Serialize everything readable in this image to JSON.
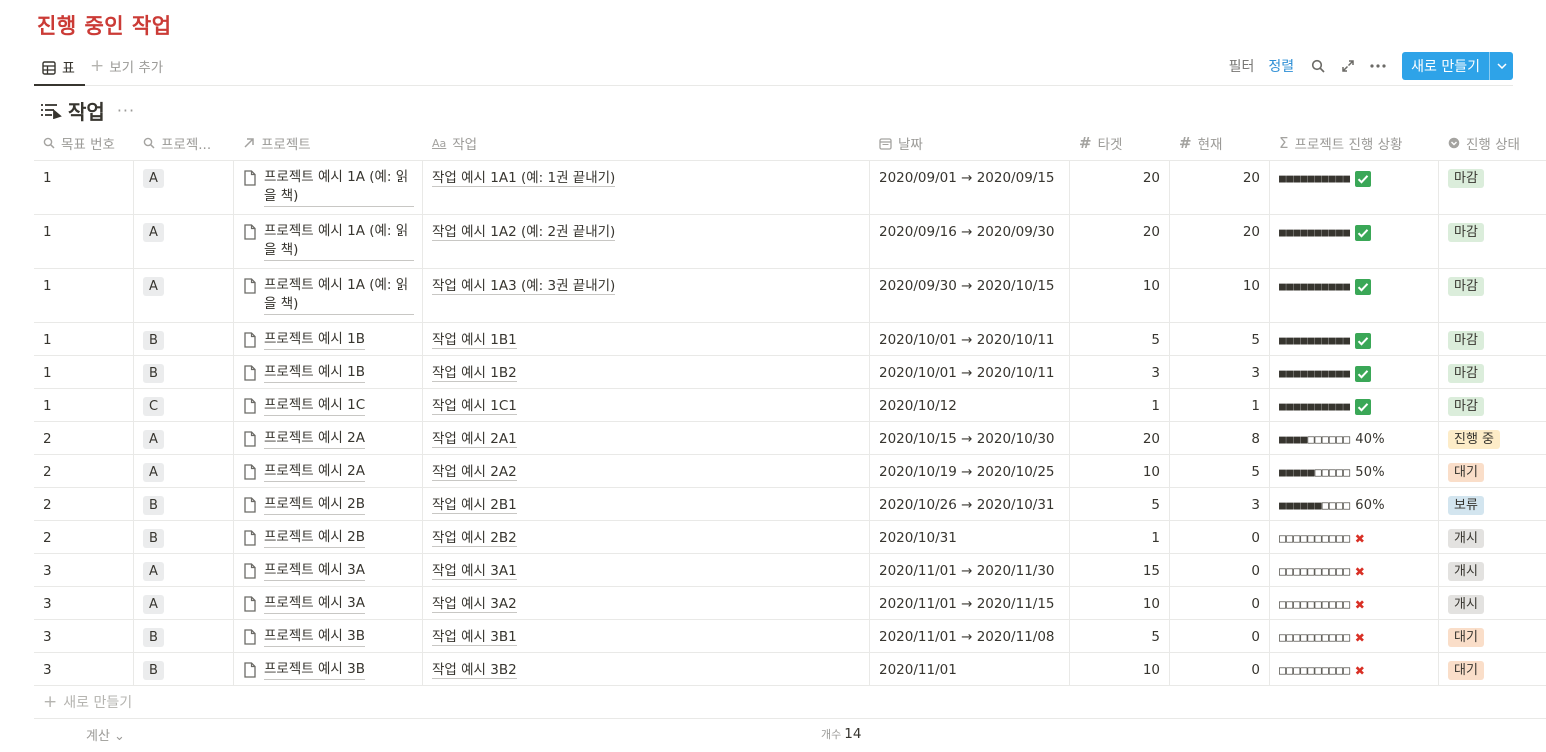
{
  "page_title": "진행 중인 작업",
  "views": {
    "active_tab": "표",
    "add_view": "보기 추가"
  },
  "toolbar": {
    "filter": "필터",
    "sort": "정렬",
    "new_label": "새로 만들기"
  },
  "database": {
    "title": "작업"
  },
  "columns": [
    "목표 번호",
    "프로젝...",
    "프로젝트",
    "작업",
    "날짜",
    "타겟",
    "현재",
    "프로젝트 진행 상황",
    "진행 상태"
  ],
  "status_colors": {
    "마감": "#dbeddb",
    "진행 중": "#fdecc8",
    "대기": "#fadec9",
    "보류": "#d3e5ef",
    "개시": "#e3e2e0"
  },
  "rows": [
    {
      "goal": "1",
      "tag": "A",
      "project": "프로젝트 예시 1A (예: 읽을 책)",
      "task": "작업 예시 1A1 (예: 1권 끝내기)",
      "date": "2020/09/01 → 2020/09/15",
      "target": "20",
      "current": "20",
      "progress": "■■■■■■■■■■",
      "pct": "",
      "done": true,
      "status": "마감"
    },
    {
      "goal": "1",
      "tag": "A",
      "project": "프로젝트 예시 1A (예: 읽을 책)",
      "task": "작업 예시 1A2 (예: 2권 끝내기)",
      "date": "2020/09/16 → 2020/09/30",
      "target": "20",
      "current": "20",
      "progress": "■■■■■■■■■■",
      "pct": "",
      "done": true,
      "status": "마감"
    },
    {
      "goal": "1",
      "tag": "A",
      "project": "프로젝트 예시 1A (예: 읽을 책)",
      "task": "작업 예시 1A3 (예: 3권 끝내기)",
      "date": "2020/09/30 → 2020/10/15",
      "target": "10",
      "current": "10",
      "progress": "■■■■■■■■■■",
      "pct": "",
      "done": true,
      "status": "마감"
    },
    {
      "goal": "1",
      "tag": "B",
      "project": "프로젝트 예시 1B",
      "task": "작업 예시 1B1",
      "date": "2020/10/01 → 2020/10/11",
      "target": "5",
      "current": "5",
      "progress": "■■■■■■■■■■",
      "pct": "",
      "done": true,
      "status": "마감"
    },
    {
      "goal": "1",
      "tag": "B",
      "project": "프로젝트 예시 1B",
      "task": "작업 예시 1B2",
      "date": "2020/10/01 → 2020/10/11",
      "target": "3",
      "current": "3",
      "progress": "■■■■■■■■■■",
      "pct": "",
      "done": true,
      "status": "마감"
    },
    {
      "goal": "1",
      "tag": "C",
      "project": "프로젝트 예시 1C",
      "task": "작업 예시 1C1",
      "date": "2020/10/12",
      "target": "1",
      "current": "1",
      "progress": "■■■■■■■■■■",
      "pct": "",
      "done": true,
      "status": "마감"
    },
    {
      "goal": "2",
      "tag": "A",
      "project": "프로젝트 예시 2A",
      "task": "작업 예시 2A1",
      "date": "2020/10/15 → 2020/10/30",
      "target": "20",
      "current": "8",
      "progress": "■■■■□□□□□□",
      "pct": "40%",
      "done": false,
      "status": "진행 중"
    },
    {
      "goal": "2",
      "tag": "A",
      "project": "프로젝트 예시 2A",
      "task": "작업 예시 2A2",
      "date": "2020/10/19 → 2020/10/25",
      "target": "10",
      "current": "5",
      "progress": "■■■■■□□□□□",
      "pct": "50%",
      "done": false,
      "status": "대기"
    },
    {
      "goal": "2",
      "tag": "B",
      "project": "프로젝트 예시 2B",
      "task": "작업 예시 2B1",
      "date": "2020/10/26 → 2020/10/31",
      "target": "5",
      "current": "3",
      "progress": "■■■■■■□□□□",
      "pct": "60%",
      "done": false,
      "status": "보류"
    },
    {
      "goal": "2",
      "tag": "B",
      "project": "프로젝트 예시 2B",
      "task": "작업 예시 2B2",
      "date": "2020/10/31",
      "target": "1",
      "current": "0",
      "progress": "□□□□□□□□□□",
      "pct": "",
      "done": false,
      "cross": true,
      "status": "개시"
    },
    {
      "goal": "3",
      "tag": "A",
      "project": "프로젝트 예시 3A",
      "task": "작업 예시 3A1",
      "date": "2020/11/01 → 2020/11/30",
      "target": "15",
      "current": "0",
      "progress": "□□□□□□□□□□",
      "pct": "",
      "done": false,
      "cross": true,
      "status": "개시"
    },
    {
      "goal": "3",
      "tag": "A",
      "project": "프로젝트 예시 3A",
      "task": "작업 예시 3A2",
      "date": "2020/11/01 → 2020/11/15",
      "target": "10",
      "current": "0",
      "progress": "□□□□□□□□□□",
      "pct": "",
      "done": false,
      "cross": true,
      "status": "개시"
    },
    {
      "goal": "3",
      "tag": "B",
      "project": "프로젝트 예시 3B",
      "task": "작업 예시 3B1",
      "date": "2020/11/01 → 2020/11/08",
      "target": "5",
      "current": "0",
      "progress": "□□□□□□□□□□",
      "pct": "",
      "done": false,
      "cross": true,
      "status": "대기"
    },
    {
      "goal": "3",
      "tag": "B",
      "project": "프로젝트 예시 3B",
      "task": "작업 예시 3B2",
      "date": "2020/11/01",
      "target": "10",
      "current": "0",
      "progress": "□□□□□□□□□□",
      "pct": "",
      "done": false,
      "cross": true,
      "status": "대기"
    }
  ],
  "new_row_label": "새로 만들기",
  "footer": {
    "calculate": "계산",
    "count_label": "개수",
    "count_value": "14"
  }
}
